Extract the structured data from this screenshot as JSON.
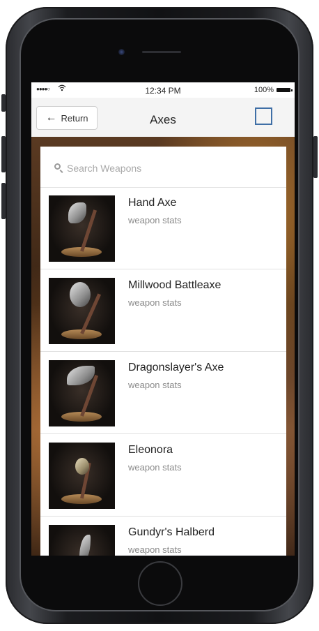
{
  "status_bar": {
    "signal": "●●●●○",
    "wifi_icon": "wifi-icon",
    "time": "12:34 PM",
    "battery": "100%"
  },
  "nav": {
    "back_label": "Return",
    "title": "Axes",
    "accent_color": "#3f6fa6"
  },
  "search": {
    "placeholder": "Search Weapons",
    "value": ""
  },
  "weapons": [
    {
      "name": "Hand Axe",
      "subtitle": "weapon stats"
    },
    {
      "name": "Millwood Battleaxe",
      "subtitle": "weapon stats"
    },
    {
      "name": "Dragonslayer's Axe",
      "subtitle": "weapon stats"
    },
    {
      "name": "Eleonora",
      "subtitle": "weapon stats"
    },
    {
      "name": "Gundyr's Halberd",
      "subtitle": "weapon stats"
    }
  ]
}
